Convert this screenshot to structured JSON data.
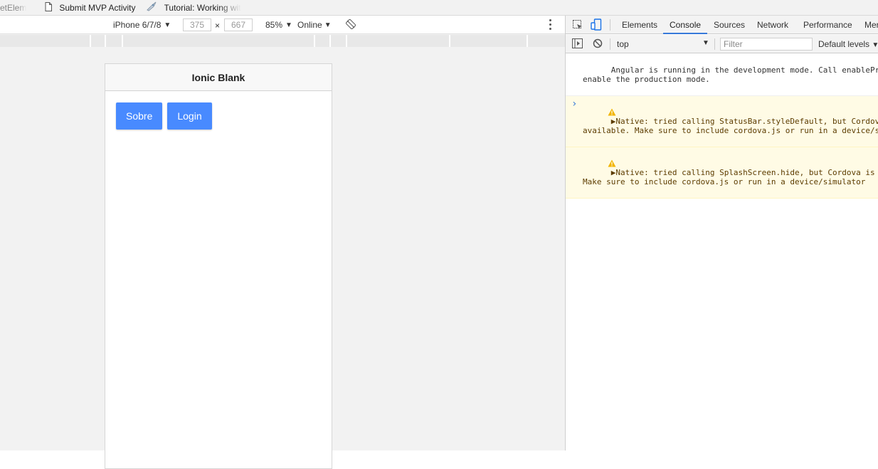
{
  "bookmarks": [
    {
      "label": "etElem",
      "icon": "page-icon",
      "faded": true
    },
    {
      "label": "Submit MVP Activity",
      "icon": "page-icon",
      "faded": false
    },
    {
      "label": "Tutorial: Working wit",
      "icon": "rocket-icon",
      "faded": false
    }
  ],
  "device_toolbar": {
    "device": "iPhone 6/7/8",
    "width": "375",
    "times": "×",
    "height": "667",
    "zoom": "85%",
    "network": "Online",
    "rotate_icon": "rotate-icon",
    "menu_icon": "kebab-menu-icon"
  },
  "app": {
    "title": "Ionic Blank",
    "buttons": [
      "Sobre",
      "Login"
    ],
    "accent": "#488aff"
  },
  "devtools": {
    "tabs": [
      "Elements",
      "Console",
      "Sources",
      "Network",
      "Performance",
      "Mer"
    ],
    "active_tab": "Console",
    "context": "top",
    "filter_placeholder": "Filter",
    "levels": "Default levels",
    "messages": [
      {
        "type": "info",
        "text": "Angular is running in the development mode. Call enableProdMode() to\nenable the production mode."
      },
      {
        "type": "warning",
        "text": "▶Native: tried calling StatusBar.styleDefault, but Cordova is not\navailable. Make sure to include cordova.js or run in a device/simulator"
      },
      {
        "type": "warning",
        "text": "▶Native: tried calling SplashScreen.hide, but Cordova is not available.\nMake sure to include cordova.js or run in a device/simulator"
      }
    ],
    "prompt": "›",
    "link_color": "#3879d9",
    "warning_bg": "#fffbe5"
  }
}
